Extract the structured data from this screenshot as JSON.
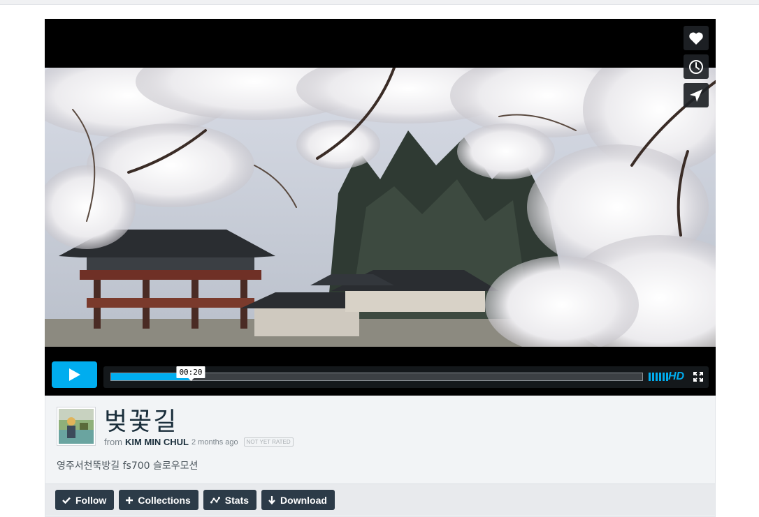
{
  "video": {
    "time_tooltip": "00:20",
    "progress_fraction": 0.15,
    "quality_label": "HD"
  },
  "clip": {
    "title": "벚꽃길",
    "from_label": "from",
    "author": "KIM MIN CHUL",
    "age": "2 months ago",
    "rating_badge": "NOT YET RATED",
    "description": "영주서천뚝방길 fs700 슬로우모션"
  },
  "actions": {
    "follow": "Follow",
    "collections": "Collections",
    "stats": "Stats",
    "download": "Download"
  },
  "colors": {
    "accent": "#00adef",
    "button_dark": "#2c3b48",
    "title_text": "#1a2e3b"
  },
  "icons": [
    "heart-icon",
    "clock-icon",
    "send-icon",
    "play-icon",
    "volume-icon",
    "fullscreen-icon",
    "check-icon",
    "plus-icon",
    "stats-icon",
    "download-icon"
  ]
}
